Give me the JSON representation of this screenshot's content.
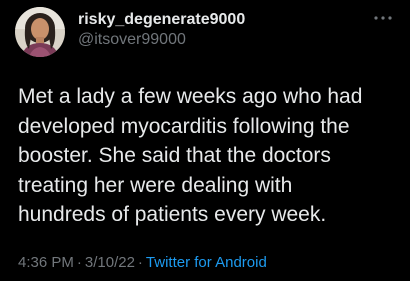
{
  "tweet": {
    "author": {
      "display_name": "risky_degenerate9000",
      "handle": "@itsover99000",
      "avatar": "profile-photo"
    },
    "more_icon": "more-horizontal-icon",
    "text": "Met a lady a few weeks ago who had\ndeveloped myocarditis following the\nbooster. She said that the doctors\ntreating her were dealing with\nhundreds of patients every week.",
    "time": "4:36 PM",
    "date": "3/10/22",
    "separator": "·",
    "source": "Twitter for Android"
  },
  "colors": {
    "background": "#000000",
    "text_primary": "#e7e9ea",
    "text_secondary": "#71767b",
    "link": "#1d9bf0"
  }
}
